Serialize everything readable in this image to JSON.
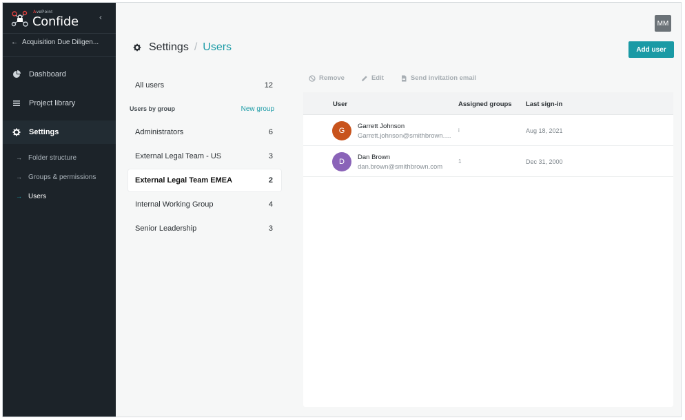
{
  "brand": {
    "vendor_a": "A",
    "vendor_rest": "vePoint",
    "product": "Confide"
  },
  "sidebar": {
    "collapse_glyph": "‹",
    "back_arrow": "←",
    "back_label": "Acquisition Due Diligen...",
    "nav": [
      {
        "label": "Dashboard",
        "icon": "pie-chart-icon"
      },
      {
        "label": "Project library",
        "icon": "list-icon"
      },
      {
        "label": "Settings",
        "icon": "gear-icon"
      }
    ],
    "sub_arrow": "→",
    "sub": [
      {
        "label": "Folder structure"
      },
      {
        "label": "Groups & permissions"
      },
      {
        "label": "Users"
      }
    ]
  },
  "header": {
    "user_initials": "MM",
    "crumb_root": "Settings",
    "crumb_sep": "/",
    "crumb_current": "Users",
    "add_user": "Add user"
  },
  "groups": {
    "all_users_label": "All users",
    "all_users_count": "12",
    "by_group_label": "Users by group",
    "new_group": "New group",
    "items": [
      {
        "label": "Administrators",
        "count": "6"
      },
      {
        "label": "External Legal Team - US",
        "count": "3"
      },
      {
        "label": "External Legal Team EMEA",
        "count": "2"
      },
      {
        "label": "Internal Working Group",
        "count": "4"
      },
      {
        "label": "Senior Leadership",
        "count": "3"
      }
    ]
  },
  "toolbar": {
    "remove": "Remove",
    "edit": "Edit",
    "send": "Send invitation email"
  },
  "table": {
    "columns": {
      "user": "User",
      "groups": "Assigned groups",
      "signin": "Last sign-in"
    },
    "rows": [
      {
        "initial": "G",
        "name": "Garrett Johnson",
        "email": "Garrett.johnson@smithbrown.com",
        "groups": "i",
        "signin": "Aug 18, 2021",
        "color": "#c8531c"
      },
      {
        "initial": "D",
        "name": "Dan Brown",
        "email": "dan.brown@smithbrown.com",
        "groups": "1",
        "signin": "Dec 31, 2000",
        "color": "#8a63b8"
      }
    ]
  },
  "colors": {
    "accent": "#1a9aa5",
    "sidebar_bg": "#1c2329"
  }
}
